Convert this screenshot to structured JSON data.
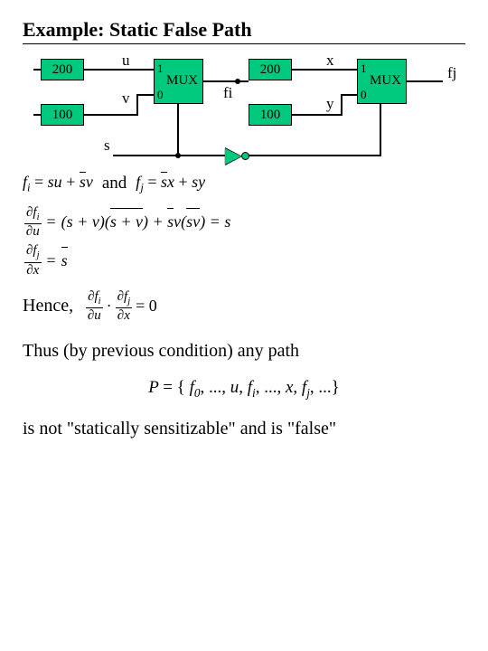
{
  "title": "Example: Static False Path",
  "diagram": {
    "block_u": "200",
    "block_v": "100",
    "block_x": "200",
    "block_y": "100",
    "u": "u",
    "v": "v",
    "s": "s",
    "x": "x",
    "y": "y",
    "fi": "fi",
    "fj": "fj",
    "mux1_one": "1",
    "mux1_zero": "0",
    "mux1_label": "MUX",
    "mux2_one": "1",
    "mux2_zero": "0",
    "mux2_label": "MUX"
  },
  "equations": {
    "and": "and",
    "fi_eq_lhs": "f",
    "fi_eq_sub": "i",
    "fi_eq_rhs": " = su + s̄v",
    "fj_eq_lhs": "f",
    "fj_eq_sub": "j",
    "fj_eq_rhs": " = s̄x + sy",
    "dfi_du": "∂f",
    "dfi_du_2": "∂u",
    "dfi_du_rhs": " = (s + v)(s + v̄) + s̄v(s̄v) = s",
    "dfj_dx": "∂f",
    "dfj_dx_2": "∂x",
    "dfj_dx_rhs": " = s̄",
    "hence": "Hence,",
    "prod_eq": " = 0",
    "thus": "Thus (by previous condition) any path",
    "pset": "P = { f₀, ..., u, fᵢ, ..., x, fⱼ, ...}",
    "conclusion": "is not \"statically sensitizable\" and is \"false\""
  }
}
